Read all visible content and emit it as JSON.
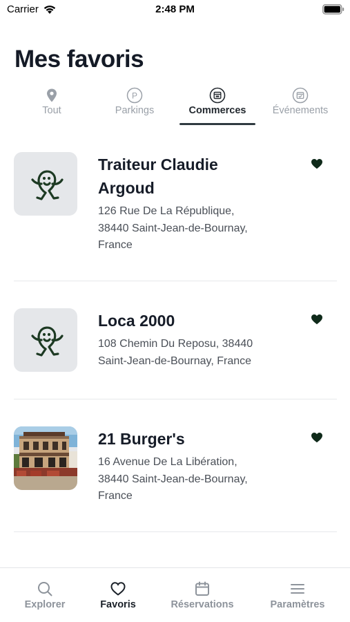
{
  "status_bar": {
    "carrier": "Carrier",
    "time": "2:48 PM"
  },
  "title": "Mes favoris",
  "tabs": [
    {
      "label": "Tout",
      "icon": "map-pin-icon",
      "active": false
    },
    {
      "label": "Parkings",
      "icon": "parking-icon",
      "active": false
    },
    {
      "label": "Commerces",
      "icon": "store-icon",
      "active": true
    },
    {
      "label": "Événements",
      "icon": "calendar-icon",
      "active": false
    }
  ],
  "favorites": [
    {
      "name_lines": [
        "Traiteur Claudie",
        "Argoud"
      ],
      "address_lines": [
        "126 Rue De La République,",
        "38440 Saint-Jean-de-Bournay,",
        "France"
      ],
      "thumbnail": "mascot-logo",
      "favorited": true
    },
    {
      "name_lines": [
        "Loca 2000"
      ],
      "address_lines": [
        "108 Chemin Du Reposu, 38440",
        "Saint-Jean-de-Bournay, France"
      ],
      "thumbnail": "mascot-logo",
      "favorited": true
    },
    {
      "name_lines": [
        "21 Burger's"
      ],
      "address_lines": [
        "16 Avenue De La Libération,",
        "38440 Saint-Jean-de-Bournay,",
        "France"
      ],
      "thumbnail": "restaurant-photo",
      "favorited": true
    }
  ],
  "tabbar": [
    {
      "label": "Explorer",
      "icon": "search-icon",
      "active": false
    },
    {
      "label": "Favoris",
      "icon": "heart-icon",
      "active": true
    },
    {
      "label": "Réservations",
      "icon": "calendar-icon",
      "active": false
    },
    {
      "label": "Paramètres",
      "icon": "menu-icon",
      "active": false
    }
  ],
  "colors": {
    "heart": "#0f2a1a",
    "mascot": "#1d3a23",
    "active_underline": "#2f3a40"
  }
}
